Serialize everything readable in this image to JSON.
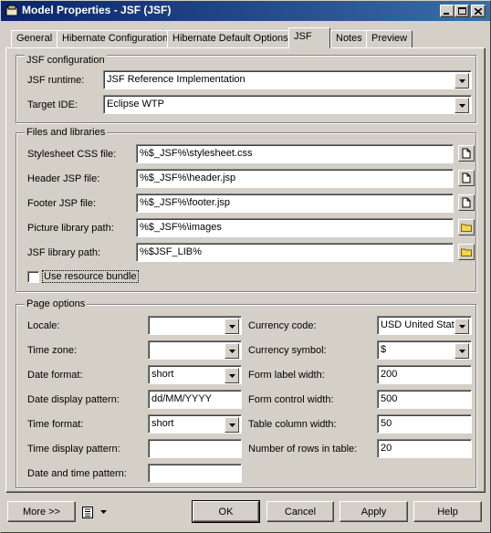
{
  "window": {
    "title": "Model Properties - JSF (JSF)",
    "icon": "model-icon",
    "controls": [
      "minimize-icon",
      "maximize-icon",
      "close-icon"
    ]
  },
  "tabs": [
    {
      "label": "General"
    },
    {
      "label": "Hibernate Configuration"
    },
    {
      "label": "Hibernate Default Options"
    },
    {
      "label": "JSF",
      "active": true
    },
    {
      "label": "Notes"
    },
    {
      "label": "Preview"
    }
  ],
  "jsf_config": {
    "legend": "JSF configuration",
    "runtime_label": "JSF runtime:",
    "runtime_value": "JSF Reference Implementation",
    "target_label": "Target IDE:",
    "target_value": "Eclipse WTP"
  },
  "files": {
    "legend": "Files and libraries",
    "stylesheet_label": "Stylesheet CSS file:",
    "stylesheet_value": "%$_JSF%\\stylesheet.css",
    "header_label": "Header JSP file:",
    "header_value": "%$_JSF%\\header.jsp",
    "footer_label": "Footer JSP file:",
    "footer_value": "%$_JSF%\\footer.jsp",
    "picture_label": "Picture library path:",
    "picture_value": "%$_JSF%\\images",
    "jsflib_label": "JSF library path:",
    "jsflib_value": "%$JSF_LIB%",
    "use_bundle_label": "Use resource bundle",
    "use_bundle_checked": false
  },
  "page_options": {
    "legend": "Page options",
    "locale_label": "Locale:",
    "locale_value": "",
    "timezone_label": "Time zone:",
    "timezone_value": "",
    "dateformat_label": "Date format:",
    "dateformat_value": "short",
    "datedisplay_label": "Date display pattern:",
    "datedisplay_value": "dd/MM/YYYY",
    "timeformat_label": "Time format:",
    "timeformat_value": "short",
    "timedisplay_label": "Time display pattern:",
    "timedisplay_value": "",
    "datetime_label": "Date and time pattern:",
    "datetime_value": "",
    "currency_code_label": "Currency code:",
    "currency_code_value": "USD United States",
    "currency_symbol_label": "Currency symbol:",
    "currency_symbol_value": "$",
    "form_label_width_label": "Form label width:",
    "form_label_width_value": "200",
    "form_control_width_label": "Form control width:",
    "form_control_width_value": "500",
    "table_column_width_label": "Table column width:",
    "table_column_width_value": "50",
    "rows_in_table_label": "Number of rows in table:",
    "rows_in_table_value": "20"
  },
  "footer": {
    "more_label": "More >>",
    "ok_label": "OK",
    "cancel_label": "Cancel",
    "apply_label": "Apply",
    "help_label": "Help"
  }
}
